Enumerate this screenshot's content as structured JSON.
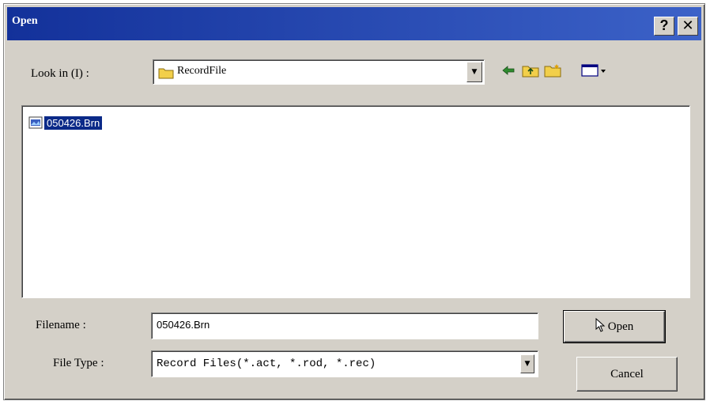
{
  "window": {
    "title": "Open",
    "help_glyph": "?",
    "close_glyph": "✕"
  },
  "look_in": {
    "label": "Look in  (I) :",
    "value": "RecordFile"
  },
  "toolbar": {
    "icons": [
      "back-arrow-icon",
      "up-folder-icon",
      "new-folder-icon",
      "view-menu-icon"
    ]
  },
  "file_list": {
    "items": [
      {
        "name": "050426.Brn",
        "icon": "file-icon",
        "selected": true
      }
    ]
  },
  "filename": {
    "label": "Filename :",
    "value": "050426.Brn"
  },
  "file_type": {
    "label": "File Type :",
    "value": "Record Files(*.act, *.rod, *.rec)"
  },
  "buttons": {
    "open_label": "Open",
    "cancel_label": "Cancel"
  },
  "colors": {
    "titlebar": "#13319a",
    "selection": "#0b2a88",
    "face": "#d4d0c8"
  }
}
